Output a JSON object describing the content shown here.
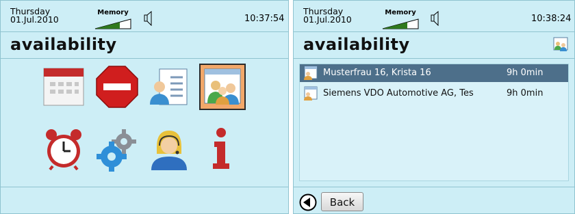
{
  "left_screen": {
    "status": {
      "day": "Thursday",
      "date": "01.Jul.2010",
      "memory_label": "Memory",
      "time": "10:37:54"
    },
    "title": "availability",
    "icons": [
      {
        "name": "calendar-icon"
      },
      {
        "name": "stop-sign-icon"
      },
      {
        "name": "contact-card-icon"
      },
      {
        "name": "availability-group-icon",
        "selected": true
      },
      {
        "name": "alarm-clock-icon"
      },
      {
        "name": "settings-gears-icon"
      },
      {
        "name": "operator-headset-icon"
      },
      {
        "name": "info-icon"
      }
    ]
  },
  "right_screen": {
    "status": {
      "day": "Thursday",
      "date": "01.Jul.2010",
      "memory_label": "Memory",
      "time": "10:38:24"
    },
    "title": "availability",
    "list": [
      {
        "name": "Musterfrau 16, Krista 16",
        "time": "9h 0min",
        "selected": true
      },
      {
        "name": "Siemens VDO Automotive AG, Tes",
        "time": "9h 0min",
        "selected": false
      }
    ],
    "back_label": "Back"
  },
  "colors": {
    "panel_bg": "#cdeef6",
    "selection": "#4d6f8a",
    "selected_tile": "#f2a86a"
  }
}
